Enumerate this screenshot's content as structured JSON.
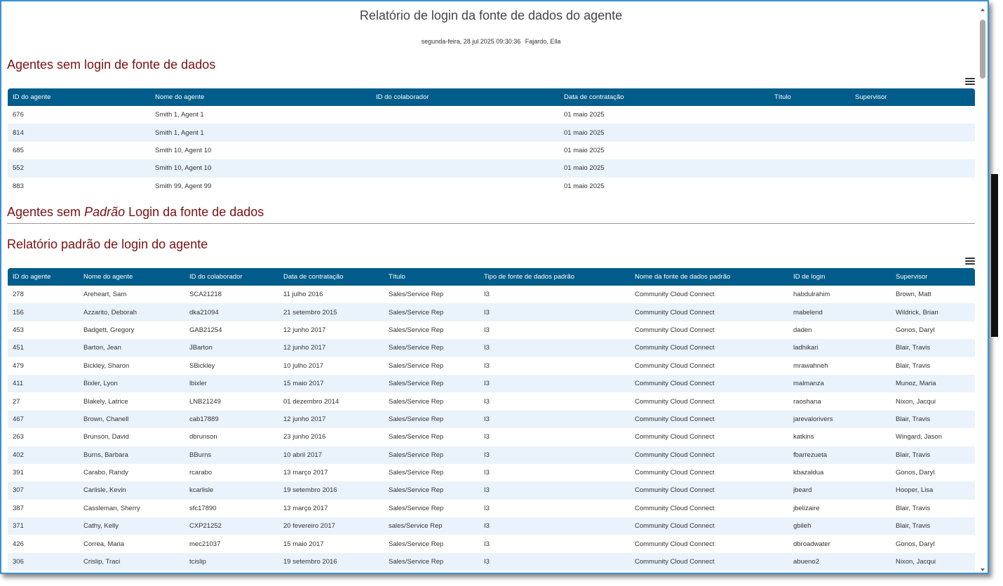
{
  "report": {
    "title": "Relatório de login da fonte de dados do agente",
    "date": "segunda-feira, 28 jul 2025 09:30:36",
    "user": "Fajardo, Ella"
  },
  "section1": {
    "heading": "Agentes sem login de fonte de dados",
    "columns": [
      "ID do agente",
      "Nome do agente",
      "ID do colaborador",
      "Data de contratação",
      "Título",
      "Supervisor"
    ],
    "rows": [
      [
        "676",
        "Smith 1, Agent 1",
        "",
        "01 maio 2025",
        "",
        ""
      ],
      [
        "814",
        "Smith 1, Agent 1",
        "",
        "01 maio 2025",
        "",
        ""
      ],
      [
        "685",
        "Smith 10, Agent 10",
        "",
        "01 maio 2025",
        "",
        ""
      ],
      [
        "552",
        "Smith 10, Agent 10",
        "",
        "01 maio 2025",
        "",
        ""
      ],
      [
        "883",
        "Smith 99, Agent 99",
        "",
        "01 maio 2025",
        "",
        ""
      ]
    ]
  },
  "section2": {
    "heading_before": "Agentes sem ",
    "heading_em": "Padrão",
    "heading_after": " Login da fonte de dados"
  },
  "section3": {
    "heading": "Relatório padrão de login do agente",
    "columns": [
      "ID do agente",
      "Nome do agente",
      "ID do colaborador",
      "Data de contratação",
      "Título",
      "Tipo de fonte de dados padrão",
      "Nome da fonte de dados padrão",
      "ID de login",
      "Supervisor"
    ],
    "rows": [
      [
        "278",
        "Areheart, Sam",
        "SCA21218",
        "11 julho 2016",
        "Sales/Service Rep",
        "I3",
        "Community Cloud Connect",
        "habdulrahim",
        "Brown, Matt"
      ],
      [
        "156",
        "Azzarito, Deborah",
        "dka21094",
        "21 setembro 2015",
        "Sales/Service Rep",
        "I3",
        "Community Cloud Connect",
        "mabelend",
        "Wildrick, Brian"
      ],
      [
        "453",
        "Badgett, Gregory",
        "GAB21254",
        "12 junho 2017",
        "Sales/Service Rep",
        "I3",
        "Community Cloud Connect",
        "daden",
        "Gonos, Daryl"
      ],
      [
        "451",
        "Barton, Jean",
        "JBarton",
        "12 junho 2017",
        "Sales/Service Rep",
        "I3",
        "Community Cloud Connect",
        "ladhikari",
        "Blair, Travis"
      ],
      [
        "479",
        "Bickley, Sharon",
        "SBickley",
        "10 julho 2017",
        "Sales/Service Rep",
        "I3",
        "Community Cloud Connect",
        "mrawahneh",
        "Blair, Travis"
      ],
      [
        "411",
        "Bixler, Lyon",
        "lbixler",
        "15 maio 2017",
        "Sales/Service Rep",
        "I3",
        "Community Cloud Connect",
        "malmanza",
        "Munoz, Maria"
      ],
      [
        "27",
        "Blakely, Latrice",
        "LNB21249",
        "01 dezembro 2014",
        "Sales/Service Rep",
        "I3",
        "Community Cloud Connect",
        "raoshana",
        "Nixon, Jacqui"
      ],
      [
        "467",
        "Brown, Chanell",
        "cab17889",
        "12 junho 2017",
        "Sales/Service Rep",
        "I3",
        "Community Cloud Connect",
        "jarevalorivers",
        "Blair, Travis"
      ],
      [
        "263",
        "Brunson, David",
        "dbrunson",
        "23 junho 2016",
        "Sales/Service Rep",
        "I3",
        "Community Cloud Connect",
        "katkins",
        "Wingard, Jason"
      ],
      [
        "402",
        "Burns, Barbara",
        "BBurns",
        "10 abril 2017",
        "Sales/Service Rep",
        "I3",
        "Community Cloud Connect",
        "fbarrezueta",
        "Blair, Travis"
      ],
      [
        "391",
        "Carabo, Randy",
        "rcarabo",
        "13 março 2017",
        "Sales/Service Rep",
        "I3",
        "Community Cloud Connect",
        "kbazaldua",
        "Gonos, Daryl"
      ],
      [
        "307",
        "Carlisle, Kevin",
        "kcarlisle",
        "19 setembro 2016",
        "Sales/Service Rep",
        "I3",
        "Community Cloud Connect",
        "jbeard",
        "Hooper, Lisa"
      ],
      [
        "387",
        "Cassleman, Sherry",
        "sfc17890",
        "13 março 2017",
        "Sales/Service Rep",
        "I3",
        "Community Cloud Connect",
        "jbelizaire",
        "Blair, Travis"
      ],
      [
        "371",
        "Cathy, Kelly",
        "CXP21252",
        "20 fevereiro 2017",
        "sales/Service Rep",
        "I3",
        "Community Cloud Connect",
        "gbileh",
        "Blair, Travis"
      ],
      [
        "426",
        "Correa, Maria",
        "mec21037",
        "15 maio 2017",
        "Sales/Service Rep",
        "I3",
        "Community Cloud Connect",
        "dbroadwater",
        "Gonos, Daryl"
      ],
      [
        "306",
        "Crislip, Traci",
        "tcislip",
        "19 setembro 2016",
        "Sales/Service Rep",
        "I3",
        "Community Cloud Connect",
        "abueno2",
        "Nixon, Jacqui"
      ]
    ]
  },
  "icons": {
    "menu": "hamburger-menu-icon"
  },
  "colors": {
    "header_bg": "#005c8a",
    "section_heading": "#7a1010",
    "row_alt": "#eaf3fb",
    "frame_border": "#3a8fd6"
  }
}
